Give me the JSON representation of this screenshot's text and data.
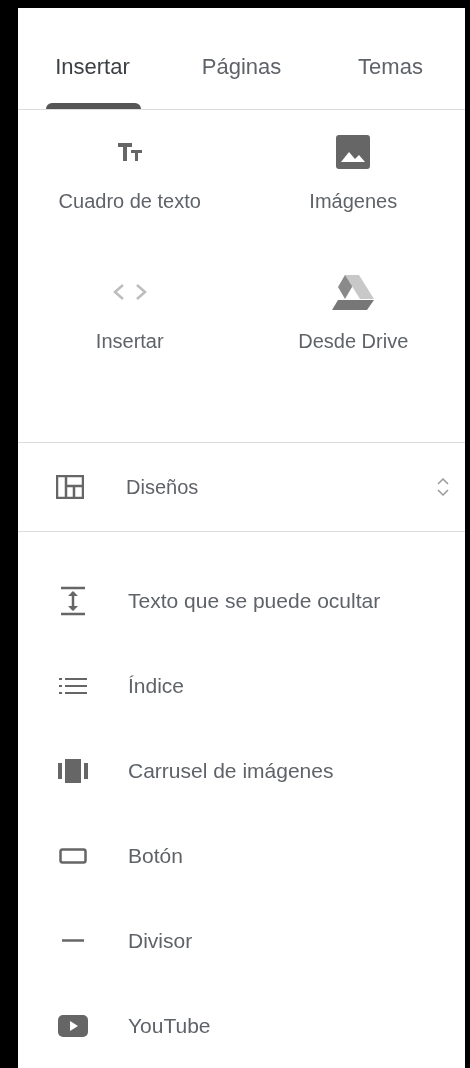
{
  "tabs": [
    {
      "label": "Insertar",
      "selected": true
    },
    {
      "label": "Páginas",
      "selected": false
    },
    {
      "label": "Temas",
      "selected": false
    }
  ],
  "tiles": [
    {
      "kind": "text",
      "label": "Cuadro de texto"
    },
    {
      "kind": "image",
      "label": "Imágenes"
    },
    {
      "kind": "embed",
      "label": "Insertar"
    },
    {
      "kind": "drive",
      "label": "Desde Drive"
    }
  ],
  "layouts": {
    "label": "Diseños",
    "expanded": false
  },
  "components": [
    {
      "kind": "collapsible",
      "label": "Texto que se puede ocultar"
    },
    {
      "kind": "toc",
      "label": "Índice"
    },
    {
      "kind": "carousel",
      "label": "Carrusel de imágenes"
    },
    {
      "kind": "button",
      "label": "Botón"
    },
    {
      "kind": "divider",
      "label": "Divisor"
    },
    {
      "kind": "youtube",
      "label": "YouTube"
    }
  ]
}
